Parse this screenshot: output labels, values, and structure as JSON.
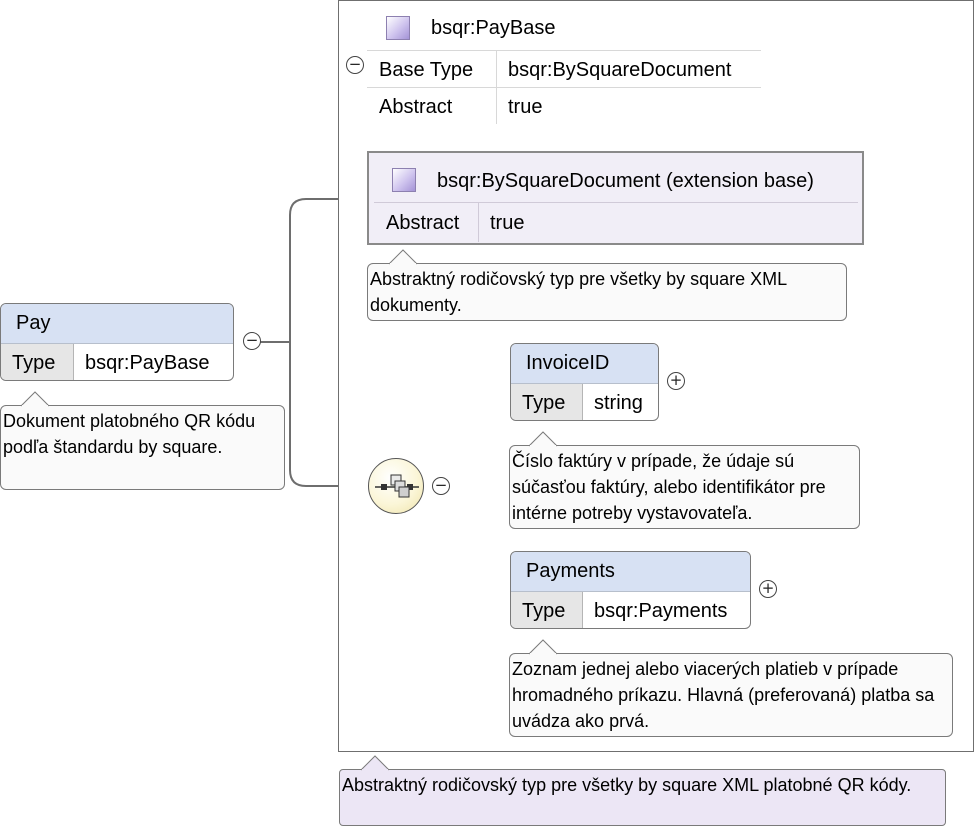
{
  "root": {
    "name": "Pay",
    "type_key": "Type",
    "type_value": "bsqr:PayBase",
    "annotation": "Dokument platobného QR kódu podľa štandardu by square.",
    "toggle": "−"
  },
  "complex_type": {
    "name": "bsqr:PayBase",
    "base_type_key": "Base Type",
    "base_type_value": "bsqr:BySquareDocument",
    "abstract_key": "Abstract",
    "abstract_value": "true",
    "toggle": "−",
    "annotation": "Abstraktný rodičovský typ pre všetky by square XML platobné QR kódy."
  },
  "extension": {
    "name": "bsqr:BySquareDocument (extension base)",
    "abstract_key": "Abstract",
    "abstract_value": "true",
    "annotation": "Abstraktný rodičovský typ pre všetky by square XML dokumenty."
  },
  "sequence": {
    "icon": "sequence-icon",
    "toggle": "−"
  },
  "children": [
    {
      "name": "InvoiceID",
      "type_key": "Type",
      "type_value": "string",
      "toggle": "+",
      "annotation": "Číslo faktúry v prípade, že údaje sú súčasťou faktúry, alebo identifikátor pre intérne potreby vystavovateľa."
    },
    {
      "name": "Payments",
      "type_key": "Type",
      "type_value": "bsqr:Payments",
      "toggle": "+",
      "annotation": "Zoznam jednej alebo viacerých platieb v prípade hromadného príkazu. Hlavná (preferovaná) platba sa uvádza ako prvá."
    }
  ],
  "colors": {
    "element_header": "#d7e1f3",
    "annotation_bg": "#fafafa",
    "extension_bg": "#f1eef7",
    "complex_annotation_bg": "#ece6f5"
  }
}
